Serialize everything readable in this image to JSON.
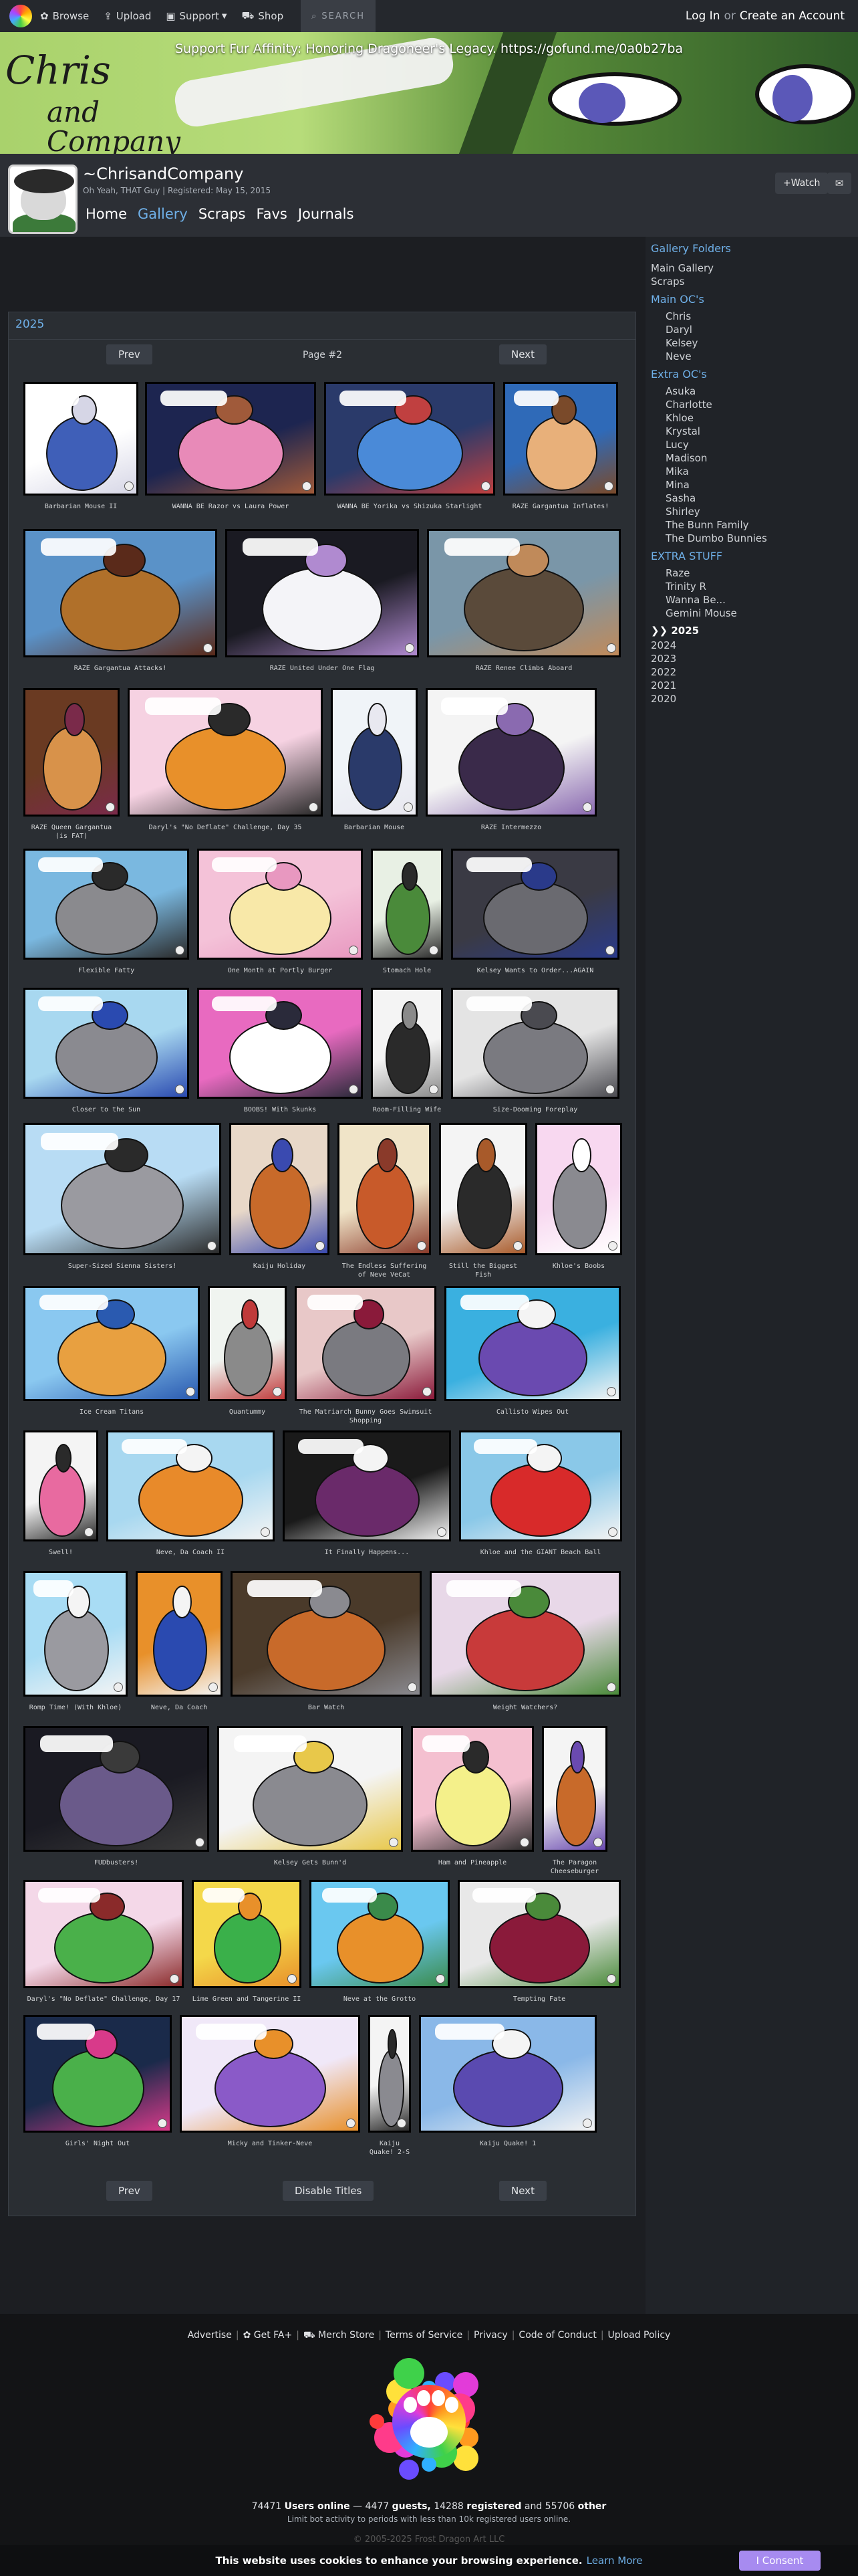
{
  "topnav": {
    "browse": "Browse",
    "upload": "Upload",
    "support": "Support",
    "shop": "Shop",
    "search_placeholder": "SEARCH",
    "login": "Log In",
    "or": "or",
    "create": "Create an Account"
  },
  "banner": {
    "support_text": "Support Fur Affinity: Honoring Dragoneer's Legacy. https://gofund.me/0a0b27ba",
    "logo_main": "Chris",
    "logo_sub": "and Company"
  },
  "user": {
    "name": "~ChrisandCompany",
    "subtitle": "Oh Yeah, THAT Guy | Registered: May 15, 2015",
    "watch": "+Watch",
    "note_icon": "envelope-icon"
  },
  "tabs": [
    "Home",
    "Gallery",
    "Scraps",
    "Favs",
    "Journals"
  ],
  "sidebar": {
    "folders_title": "Gallery Folders",
    "main_links": [
      "Main Gallery",
      "Scraps"
    ],
    "main_oc_title": "Main OC's",
    "main_ocs": [
      "Chris",
      "Daryl",
      "Kelsey",
      "Neve"
    ],
    "extra_oc_title": "Extra OC's",
    "extra_ocs": [
      "Asuka",
      "Charlotte",
      "Khloe",
      "Krystal",
      "Lucy",
      "Madison",
      "Mika",
      "Mina",
      "Sasha",
      "Shirley",
      "The Bunn Family",
      "The Dumbo Bunnies"
    ],
    "extra_stuff_title": "EXTRA STUFF",
    "extra_stuff": [
      "Raze",
      "Trinity R",
      "Wanna Be...",
      "Gemini Mouse"
    ],
    "years_current": "❯❯ 2025",
    "years": [
      "2024",
      "2023",
      "2022",
      "2021",
      "2020"
    ]
  },
  "gallery": {
    "title": "2025",
    "prev": "Prev",
    "next": "Next",
    "page": "Page #2",
    "disable_titles": "Disable Titles",
    "items": [
      {
        "title": "Barbarian Mouse II",
        "colors": [
          "#ffffff",
          "#3f5fb8",
          "#d6d6e6"
        ]
      },
      {
        "title": "WANNA BE Razor vs Laura Power",
        "colors": [
          "#1d2550",
          "#e88ab8",
          "#a05a3a"
        ]
      },
      {
        "title": "WANNA BE Yorika vs Shizuka Starlight",
        "colors": [
          "#2a3a6a",
          "#4a8ad8",
          "#c04040"
        ]
      },
      {
        "title": "RAZE Gargantua Inflates!",
        "colors": [
          "#2f6ab8",
          "#e8b07a",
          "#7a4a2a"
        ]
      },
      {
        "title": "RAZE Gargantua Attacks!",
        "colors": [
          "#5a92c8",
          "#b0702a",
          "#5a2a1a"
        ]
      },
      {
        "title": "RAZE United Under One Flag",
        "colors": [
          "#1a1a22",
          "#f4f4f8",
          "#b08ad0"
        ]
      },
      {
        "title": "RAZE Renee Climbs Aboard",
        "colors": [
          "#7a96a8",
          "#5a4a3a",
          "#c08a5a"
        ]
      },
      {
        "title": "RAZE Queen Gargantua (is FAT)",
        "colors": [
          "#6a3a22",
          "#d8924a",
          "#7a2a4a"
        ]
      },
      {
        "title": "Daryl's \"No Deflate\" Challenge, Day 35",
        "colors": [
          "#f6d2e2",
          "#e8902a",
          "#2a2a2a"
        ]
      },
      {
        "title": "Barbarian Mouse",
        "colors": [
          "#f0f4f8",
          "#2a3a6a",
          "#e8e8f0"
        ]
      },
      {
        "title": "RAZE Intermezzo",
        "colors": [
          "#f4f4f4",
          "#3a2a4a",
          "#8a6ab0"
        ]
      },
      {
        "title": "Flexible Fatty",
        "colors": [
          "#7ab8e0",
          "#8a8a8e",
          "#2a2a2a"
        ]
      },
      {
        "title": "One Month at Portly Burger",
        "colors": [
          "#f4c2d8",
          "#f8e8a8",
          "#e898c0"
        ]
      },
      {
        "title": "Stomach Hole",
        "colors": [
          "#e8f0e4",
          "#4a8a3a",
          "#2a2a2a"
        ]
      },
      {
        "title": "Kelsey Wants to Order...AGAIN",
        "colors": [
          "#3a3a44",
          "#6a6a70",
          "#2a3a8a"
        ]
      },
      {
        "title": "Closer to the Sun",
        "colors": [
          "#a8d8f0",
          "#8a8a90",
          "#2a4ab0"
        ]
      },
      {
        "title": "BOOBS! With Skunks",
        "colors": [
          "#e86ac0",
          "#ffffff",
          "#2a2a3a"
        ]
      },
      {
        "title": "Room-Filling Wife",
        "colors": [
          "#f4f4f4",
          "#2a2a2a",
          "#8a8a8a"
        ]
      },
      {
        "title": "Size-Dooming Foreplay",
        "colors": [
          "#e4e4e4",
          "#7a7a80",
          "#4a4a50"
        ]
      },
      {
        "title": "Super-Sized Sienna Sisters!",
        "colors": [
          "#b8dcf4",
          "#9a9aa0",
          "#2a2a2a"
        ]
      },
      {
        "title": "Kaiju Holiday",
        "colors": [
          "#e8d8c8",
          "#c86a2a",
          "#3a4ab0"
        ]
      },
      {
        "title": "The Endless Suffering of Neve VeCat",
        "colors": [
          "#f0e4c8",
          "#c85a2a",
          "#8a3a2a"
        ]
      },
      {
        "title": "Still the Biggest Fish",
        "colors": [
          "#f4f4f4",
          "#2a2a2a",
          "#a85a2a"
        ]
      },
      {
        "title": "Khloe's Boobs",
        "colors": [
          "#f8d8f0",
          "#8a8a90",
          "#ffffff"
        ]
      },
      {
        "title": "Ice Cream Titans",
        "colors": [
          "#8ac8f0",
          "#e8a040",
          "#2a5ab0"
        ]
      },
      {
        "title": "Quantummy",
        "colors": [
          "#f0f4f0",
          "#8a8a8a",
          "#c03a3a"
        ]
      },
      {
        "title": "The Matriarch Bunny Goes Swimsuit Shopping",
        "colors": [
          "#e8c8c8",
          "#7a7a80",
          "#8a1a3a"
        ]
      },
      {
        "title": "Callisto Wipes Out",
        "colors": [
          "#3ab0e0",
          "#6a4ab0",
          "#f4f4f4"
        ]
      },
      {
        "title": "Swell!",
        "colors": [
          "#f4f4f4",
          "#e86aa0",
          "#2a2a2a"
        ]
      },
      {
        "title": "Neve, Da Coach II",
        "colors": [
          "#a8d8f0",
          "#e88a2a",
          "#f4f4f4"
        ]
      },
      {
        "title": "It Finally Happens...",
        "colors": [
          "#1a1a1a",
          "#6a2a6a",
          "#f4f4f4"
        ]
      },
      {
        "title": "Khloe and the GIANT Beach Ball",
        "colors": [
          "#8ac8e8",
          "#d82a2a",
          "#f4f4f4"
        ]
      },
      {
        "title": "Romp Time! (With Khloe)",
        "colors": [
          "#a8dcf4",
          "#9a9aa0",
          "#f4f4f4"
        ]
      },
      {
        "title": "Neve, Da Coach",
        "colors": [
          "#e8902a",
          "#2a4ab0",
          "#f4f4f4"
        ]
      },
      {
        "title": "Bar Watch",
        "colors": [
          "#4a3a2a",
          "#c86a2a",
          "#8a8a90"
        ]
      },
      {
        "title": "Weight Watchers?",
        "colors": [
          "#e8d8e8",
          "#c83a3a",
          "#4a8a3a"
        ]
      },
      {
        "title": "FUDbusters!",
        "colors": [
          "#1a1a22",
          "#6a5a8a",
          "#3a3a3a"
        ]
      },
      {
        "title": "Kelsey Gets Bunn'd",
        "colors": [
          "#f4f4f4",
          "#8a8a90",
          "#e8c84a"
        ]
      },
      {
        "title": "Ham and Pineapple",
        "colors": [
          "#f4c0d0",
          "#f4f08a",
          "#2a2a2a"
        ]
      },
      {
        "title": "The Paragon Cheeseburger",
        "colors": [
          "#f4f4f4",
          "#c86a2a",
          "#6a4ab0"
        ]
      },
      {
        "title": "Daryl's \"No Deflate\" Challenge, Day 17",
        "colors": [
          "#f4d8e8",
          "#4ab04a",
          "#8a2a2a"
        ]
      },
      {
        "title": "Lime Green and Tangerine II",
        "colors": [
          "#f4d84a",
          "#3ab04a",
          "#e8902a"
        ]
      },
      {
        "title": "Neve at the Grotto",
        "colors": [
          "#6ac8f0",
          "#e8902a",
          "#3a8a4a"
        ]
      },
      {
        "title": "Tempting Fate",
        "colors": [
          "#e8e8e8",
          "#8a1a3a",
          "#4a8a3a"
        ]
      },
      {
        "title": "Girls' Night Out",
        "colors": [
          "#1a2a4a",
          "#4ab04a",
          "#d83a8a"
        ]
      },
      {
        "title": "Micky and Tinker-Neve",
        "colors": [
          "#f0e8f8",
          "#8a5ac8",
          "#e8902a"
        ]
      },
      {
        "title": "Kaiju Quake! 2-S",
        "colors": [
          "#f4f4f4",
          "#8a8a90",
          "#2a2a2a"
        ]
      },
      {
        "title": "Kaiju Quake! 1",
        "colors": [
          "#8ab8e8",
          "#5a4ab0",
          "#f4f4f4"
        ]
      }
    ]
  },
  "footer": {
    "links": [
      "Advertise",
      "Get FA+",
      "Merch Store",
      "Terms of Service",
      "Privacy",
      "Code of Conduct",
      "Upload Policy"
    ],
    "online_users": "74471",
    "online_label": "Users online",
    "guests": "4477",
    "guests_label": "guests,",
    "registered": "14288",
    "registered_label": "registered",
    "and": "and",
    "other": "55706",
    "other_label": "other",
    "limit_note": "Limit bot activity to periods with less than 10k registered users online.",
    "copyright": "© 2005-2025 Frost Dragon Art LLC",
    "cookie_text": "This website uses cookies to enhance your browsing experience.",
    "cookie_more": "Learn More",
    "consent": "I Consent"
  }
}
